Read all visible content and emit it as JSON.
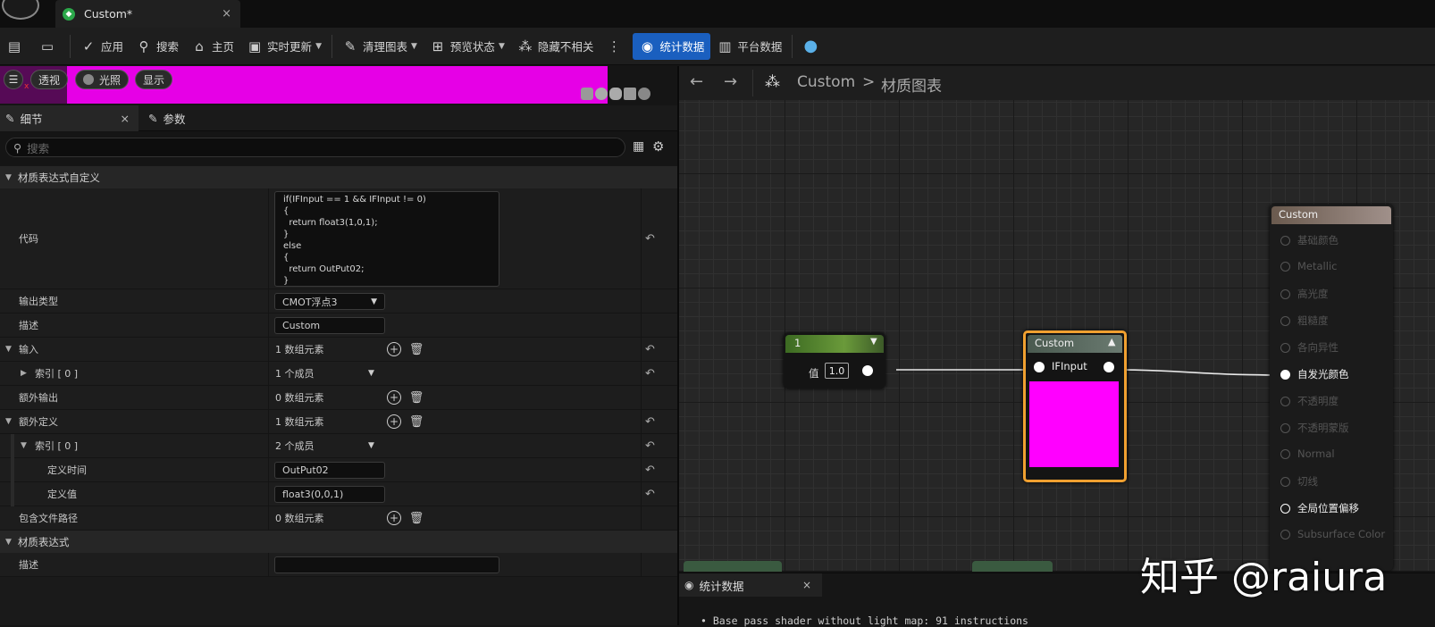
{
  "window": {
    "tab_title": "Custom*",
    "tab_close": "×"
  },
  "toolbar": {
    "apply": "应用",
    "search": "搜索",
    "home": "主页",
    "live_update": "实时更新",
    "clean_graph": "清理图表",
    "preview_state": "预览状态",
    "hide_unrelated": "隐藏不相关",
    "stats": "统计数据",
    "platform_stats": "平台数据"
  },
  "viewport": {
    "perspective": "透视",
    "lit": "光照",
    "show": "显示"
  },
  "details": {
    "tab_details": "细节",
    "tab_params": "参数",
    "close": "×",
    "search_placeholder": "搜索",
    "section_custom": "材质表达式自定义",
    "code_label": "代码",
    "code_lines": [
      "if(IFInput == 1 && IFInput != 0)",
      "{",
      "  return float3(1,0,1);",
      "}",
      "else",
      "{",
      "  return OutPut02;",
      "}"
    ],
    "output_type_label": "输出类型",
    "output_type_value": "CMOT浮点3",
    "description_label": "描述",
    "description_value": "Custom",
    "inputs_label": "输入",
    "inputs_value": "1 数组元素",
    "index0_label": "索引 [ 0 ]",
    "index0_value": "1 个成员",
    "extra_outputs_label": "额外输出",
    "extra_outputs_value": "0 数组元素",
    "extra_defines_label": "额外定义",
    "extra_defines_value": "1 数组元素",
    "index0b_label": "索引 [ 0 ]",
    "index0b_value": "2 个成员",
    "define_time_label": "定义时间",
    "define_time_value": "OutPut02",
    "define_value_label": "定义值",
    "define_value_value": "float3(0,0,1)",
    "include_paths_label": "包含文件路径",
    "include_paths_value": "0 数组元素",
    "section_expression": "材质表达式",
    "desc2_label": "描述",
    "desc2_value": ""
  },
  "graph": {
    "breadcrumb_root": "Custom",
    "breadcrumb_sep": ">",
    "breadcrumb_current": "材质图表",
    "const_node_title": "1",
    "const_value_label": "值",
    "const_value": "1.0",
    "custom_node_title": "Custom",
    "custom_input": "IFInput",
    "preview_color": "#ff00ff",
    "result_node_title": "Custom",
    "result_outputs": [
      "基础颜色",
      "Metallic",
      "高光度",
      "粗糙度",
      "各向异性",
      "自发光颜色",
      "不透明度",
      "不透明蒙版",
      "Normal",
      "切线",
      "全局位置偏移",
      "Subsurface Color"
    ],
    "active_outputs": [
      "自发光颜色",
      "全局位置偏移"
    ]
  },
  "stats_panel": {
    "title": "统计数据",
    "close": "×",
    "line1": "Base pass shader without light map: 91 instructions"
  },
  "watermark": "知乎 @raiura",
  "colors": {
    "accent": "#1a5fbf",
    "preview_magenta": "#e600e6",
    "node_select": "#f0a030",
    "const_header": "#4a7a2a"
  }
}
